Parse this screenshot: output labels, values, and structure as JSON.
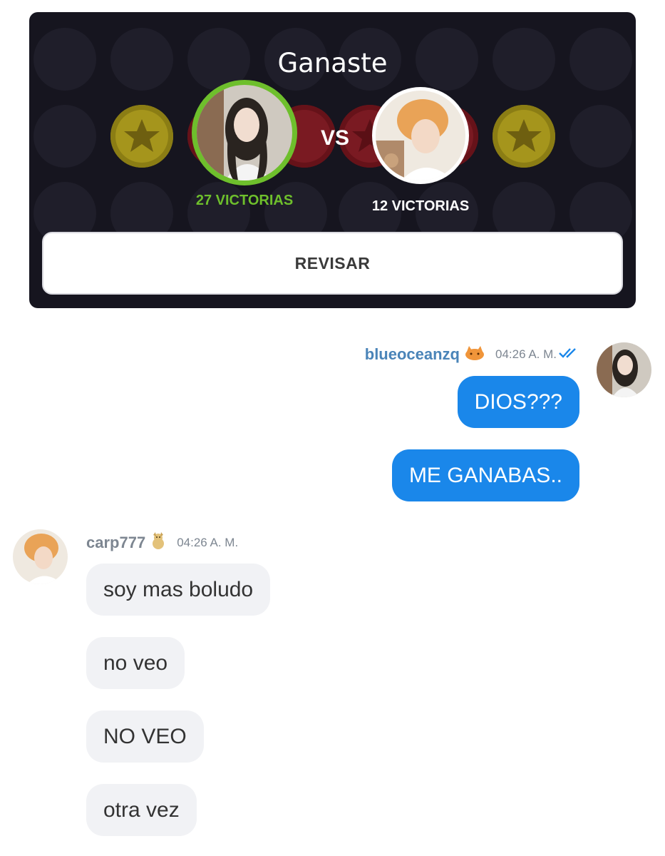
{
  "game": {
    "title": "Ganaste",
    "vs_label": "VS",
    "player1": {
      "wins": "27 VICTORIAS",
      "status": "winner"
    },
    "player2": {
      "wins": "12 VICTORIAS"
    },
    "review_button": "REVISAR",
    "colors": {
      "winner_ring": "#6ebf2c",
      "card_bg": "#16151f"
    }
  },
  "chat": {
    "outgoing": {
      "username": "blueoceanzq",
      "time": "04:26 A. M.",
      "read_status": "double-check-icon",
      "messages": [
        "DIOS???",
        "ME GANABAS.."
      ]
    },
    "incoming": {
      "username": "carp777",
      "time": "04:26 A. M.",
      "messages": [
        "soy mas boludo",
        "no veo",
        "NO VEO",
        "otra vez"
      ]
    },
    "colors": {
      "outgoing_bubble": "#1a87ea",
      "incoming_bubble": "#f1f2f5"
    }
  }
}
